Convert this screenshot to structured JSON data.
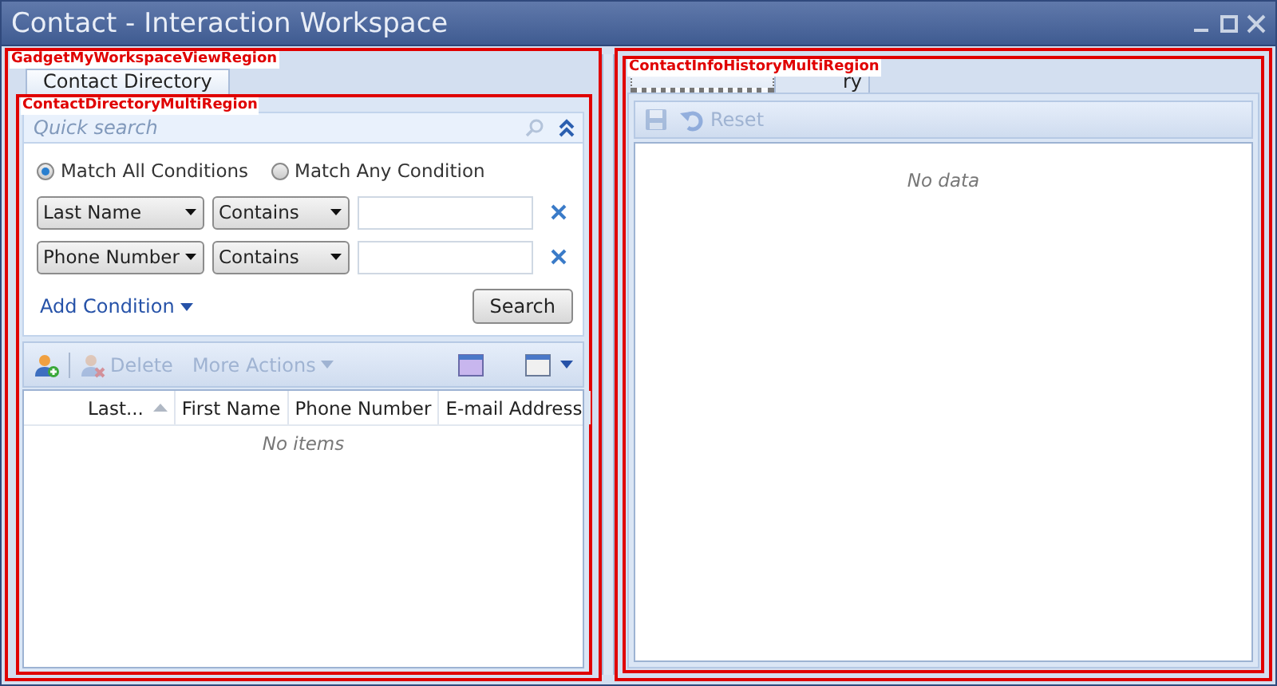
{
  "window": {
    "title": "Contact - Interaction Workspace"
  },
  "left_panel": {
    "region_label": "GadgetMyWorkspaceViewRegion",
    "tabs": [
      {
        "label": "Contact Directory",
        "selected": true
      }
    ],
    "inner_region_label": "ContactDirectoryMultiRegion",
    "quick_search": {
      "placeholder": "Quick search"
    },
    "match_options": [
      {
        "label": "Match All Conditions",
        "selected": true
      },
      {
        "label": "Match Any Condition",
        "selected": false
      }
    ],
    "conditions": [
      {
        "field": "Last Name",
        "operator": "Contains"
      },
      {
        "field": "Phone Number",
        "operator": "Contains"
      }
    ],
    "add_condition": "Add Condition",
    "search_button": "Search",
    "toolbar": [
      {
        "kind": "add",
        "disabled": false
      },
      {
        "kind": "delete",
        "label": "Delete",
        "disabled": true
      },
      {
        "kind": "menu",
        "label": "More Actions",
        "disabled": true
      }
    ],
    "table": {
      "columns": [
        {
          "label": "Last...",
          "sorted": true
        },
        {
          "label": "First Name",
          "sorted": false
        },
        {
          "label": "Phone Number",
          "sorted": false
        },
        {
          "label": "E-mail Address",
          "sorted": false
        }
      ],
      "empty_text": "No items"
    }
  },
  "right_panel": {
    "region_label": "ContactInfoHistoryMultiRegion",
    "tabs": [
      {
        "selected": true
      },
      {
        "label": "ry",
        "selected": false
      }
    ],
    "toolbar": [
      {
        "kind": "save",
        "disabled": true
      },
      {
        "kind": "reset",
        "label": "Reset",
        "disabled": true
      }
    ],
    "empty_text": "No data"
  }
}
